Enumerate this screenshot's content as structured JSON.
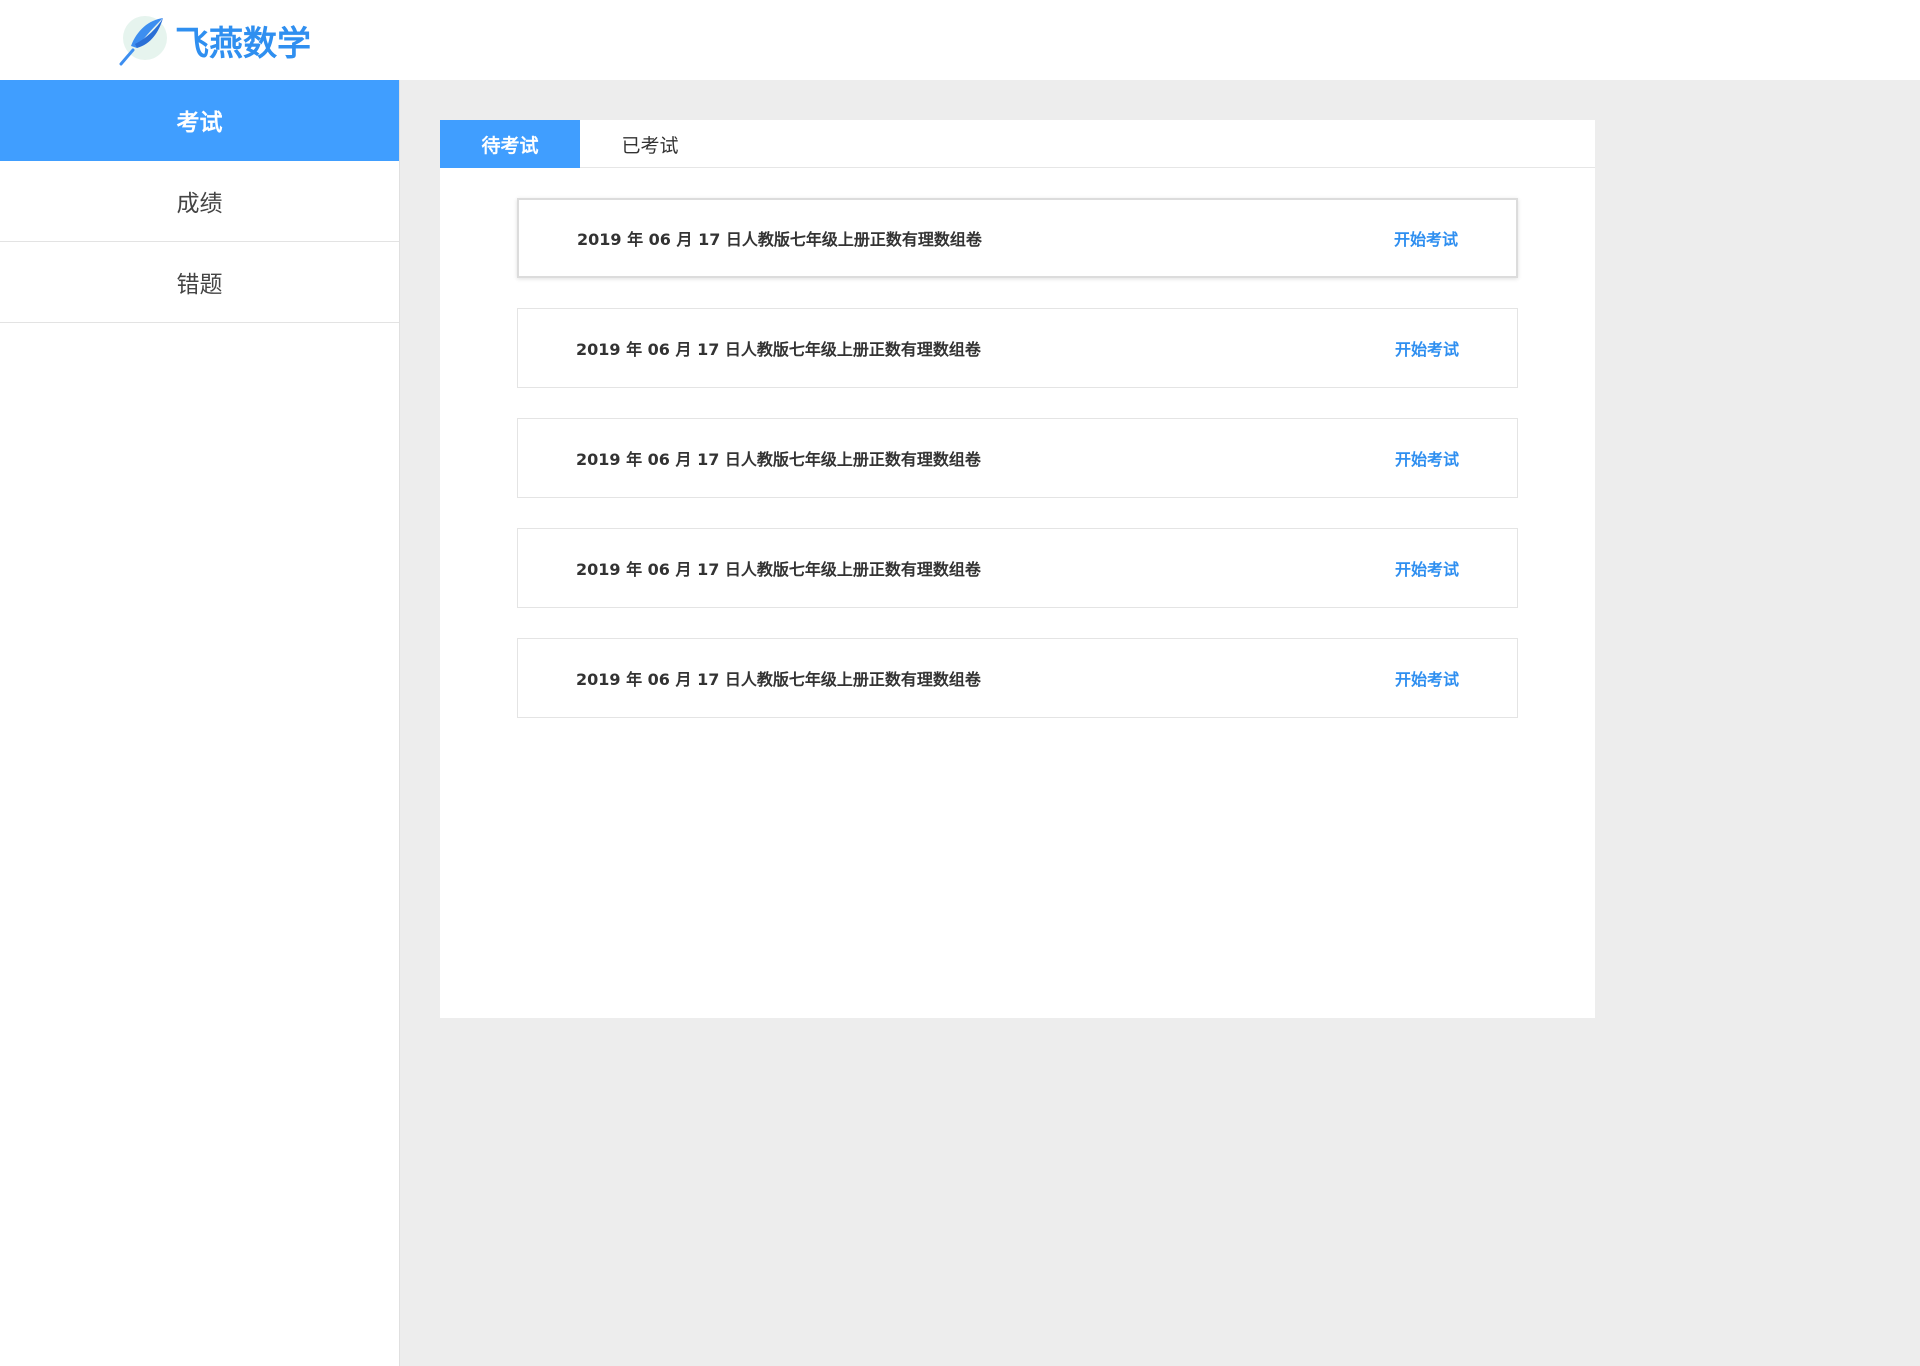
{
  "header": {
    "logo_text": "飞燕数学"
  },
  "sidebar": {
    "items": [
      {
        "label": "考试",
        "active": true
      },
      {
        "label": "成绩",
        "active": false
      },
      {
        "label": "错题",
        "active": false
      }
    ]
  },
  "tabs": [
    {
      "label": "待考试",
      "active": true
    },
    {
      "label": "已考试",
      "active": false
    }
  ],
  "exams": [
    {
      "title": "2019 年 06 月 17 日人教版七年级上册正数有理数组卷",
      "action": "开始考试"
    },
    {
      "title": "2019 年 06 月 17 日人教版七年级上册正数有理数组卷",
      "action": "开始考试"
    },
    {
      "title": "2019 年 06 月 17 日人教版七年级上册正数有理数组卷",
      "action": "开始考试"
    },
    {
      "title": "2019 年 06 月 17 日人教版七年级上册正数有理数组卷",
      "action": "开始考试"
    },
    {
      "title": "2019 年 06 月 17 日人教版七年级上册正数有理数组卷",
      "action": "开始考试"
    }
  ],
  "colors": {
    "accent": "#409eff",
    "link": "#2f8ff0",
    "background": "#ededed"
  },
  "icons": {
    "logo": "feather-pen-logo-icon"
  }
}
